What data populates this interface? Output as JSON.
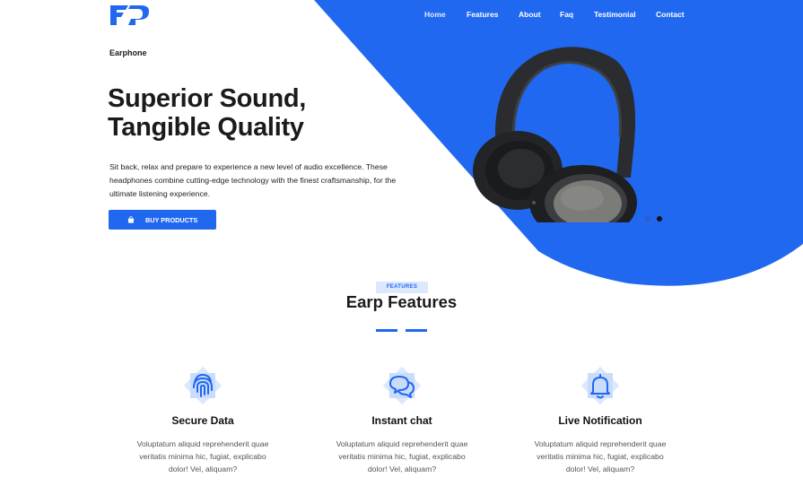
{
  "nav": {
    "items": [
      {
        "label": "Home",
        "active": true
      },
      {
        "label": "Features",
        "active": false
      },
      {
        "label": "About",
        "active": false
      },
      {
        "label": "Faq",
        "active": false
      },
      {
        "label": "Testimonial",
        "active": false
      },
      {
        "label": "Contact",
        "active": false
      }
    ]
  },
  "logo": {
    "icon": "ep-logo-icon",
    "color": "#2168f0"
  },
  "hero": {
    "eyebrow": "Earphone",
    "headline_line1": "Superior Sound,",
    "headline_line2": "Tangible Quality",
    "description": "Sit back, relax and prepare to experience a new level of audio excellence. These headphones combine cutting-edge technology with the finest craftsmanship, for the ultimate listening experience.",
    "cta_label": "BUY PRODUCTS",
    "cta_icon": "shopping-bag-icon",
    "product_image": "headphones-image",
    "slider_dots": [
      {
        "active": false
      },
      {
        "active": true
      }
    ]
  },
  "features_section": {
    "badge": "FEATURES",
    "title": "Earp Features",
    "items": [
      {
        "icon": "fingerprint-icon",
        "title": "Secure Data",
        "text": "Voluptatum aliquid reprehenderit quae veritatis minima hic, fugiat, explicabo dolor! Vel, aliquam?"
      },
      {
        "icon": "chat-bubbles-icon",
        "title": "Instant chat",
        "text": "Voluptatum aliquid reprehenderit quae veritatis minima hic, fugiat, explicabo dolor! Vel, aliquam?"
      },
      {
        "icon": "bell-icon",
        "title": "Live Notification",
        "text": "Voluptatum aliquid reprehenderit quae veritatis minima hic, fugiat, explicabo dolor! Vel, aliquam?"
      }
    ]
  },
  "colors": {
    "accent": "#2168f0",
    "badge_bg": "#dbe8fd",
    "text_dark": "#1b1b1b",
    "text_muted": "#555555"
  }
}
